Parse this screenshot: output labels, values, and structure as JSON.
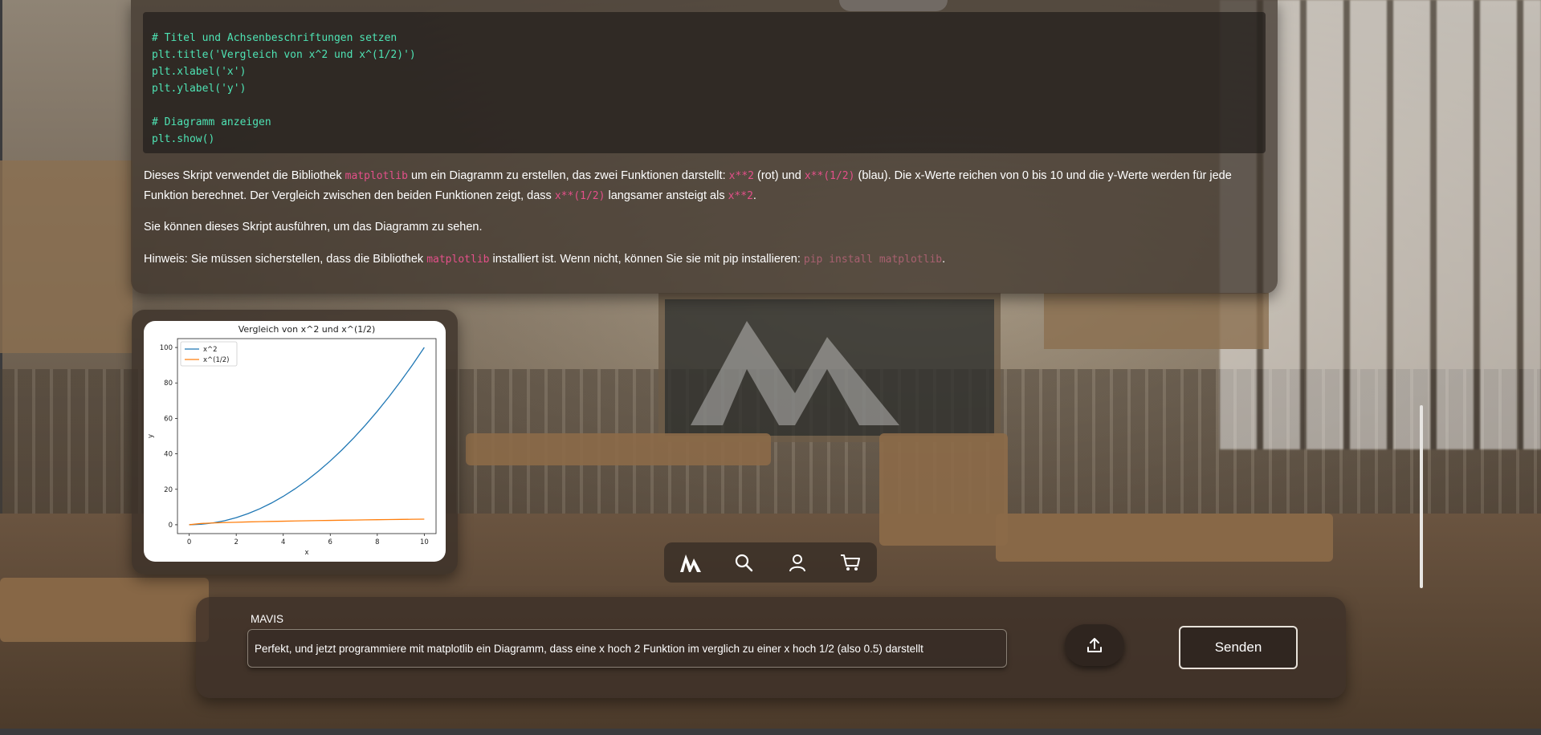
{
  "code": {
    "lines": [
      "# Titel und Achsenbeschriftungen setzen",
      "plt.title('Vergleich von x^2 und x^(1/2)')",
      "plt.xlabel('x')",
      "plt.ylabel('y')",
      "",
      "# Diagramm anzeigen",
      "plt.show()"
    ]
  },
  "explanation": {
    "p1_a": "Dieses Skript verwendet die Bibliothek ",
    "p1_lib": "matplotlib",
    "p1_b": " um ein Diagramm zu erstellen, das zwei Funktionen darstellt: ",
    "p1_f1": "x**2",
    "p1_c": " (rot) und ",
    "p1_f2": "x**(1/2)",
    "p1_d": " (blau). Die x-Werte reichen von 0 bis 10 und die y-Werte werden für jede",
    "p1_e": "Funktion berechnet. Der Vergleich zwischen den beiden Funktionen zeigt, dass ",
    "p1_f3": "x**(1/2)",
    "p1_f": " langsamer ansteigt als ",
    "p1_f4": "x**2",
    "p1_g": ".",
    "p2": "Sie können dieses Skript ausführen, um das Diagramm zu sehen.",
    "p3_a": "Hinweis: Sie müssen sicherstellen, dass die Bibliothek ",
    "p3_lib": "matplotlib",
    "p3_b": " installiert ist. Wenn nicht, können Sie sie mit pip installieren: ",
    "p3_cmd": "pip install matplotlib",
    "p3_c": "."
  },
  "chart_data": {
    "type": "line",
    "title": "Vergleich von x^2 und x^(1/2)",
    "xlabel": "x",
    "ylabel": "y",
    "xlim": [
      -0.5,
      10.5
    ],
    "ylim": [
      -5,
      105
    ],
    "xticks": [
      0,
      2,
      4,
      6,
      8,
      10
    ],
    "yticks": [
      0,
      20,
      40,
      60,
      80,
      100
    ],
    "legend": "top-left",
    "x": [
      0,
      0.5,
      1,
      1.5,
      2,
      2.5,
      3,
      3.5,
      4,
      4.5,
      5,
      5.5,
      6,
      6.5,
      7,
      7.5,
      8,
      8.5,
      9,
      9.5,
      10
    ],
    "series": [
      {
        "name": "x^2",
        "color": "#1f77b4",
        "values": [
          0,
          0.25,
          1,
          2.25,
          4,
          6.25,
          9,
          12.25,
          16,
          20.25,
          25,
          30.25,
          36,
          42.25,
          49,
          56.25,
          64,
          72.25,
          81,
          90.25,
          100
        ]
      },
      {
        "name": "x^(1/2)",
        "color": "#ff7f0e",
        "values": [
          0,
          0.71,
          1,
          1.22,
          1.41,
          1.58,
          1.73,
          1.87,
          2,
          2.12,
          2.24,
          2.35,
          2.45,
          2.55,
          2.65,
          2.74,
          2.83,
          2.92,
          3,
          3.08,
          3.16
        ]
      }
    ]
  },
  "nav": {
    "items": [
      {
        "icon": "mavis-logo-icon"
      },
      {
        "icon": "search-icon"
      },
      {
        "icon": "user-icon"
      },
      {
        "icon": "cart-icon"
      }
    ]
  },
  "input": {
    "label": "MAVIS",
    "value": "Perfekt, und jetzt programmiere mit matplotlib ein Diagramm, dass eine x hoch 2 Funktion im verglich zu einer x hoch 1/2 (also 0.5) darstellt",
    "upload_icon": "upload-icon",
    "send_label": "Senden"
  },
  "colors": {
    "code_text": "#4ee3b4",
    "inline_code": "#e4508a",
    "panel_bg": "#3a3028"
  }
}
